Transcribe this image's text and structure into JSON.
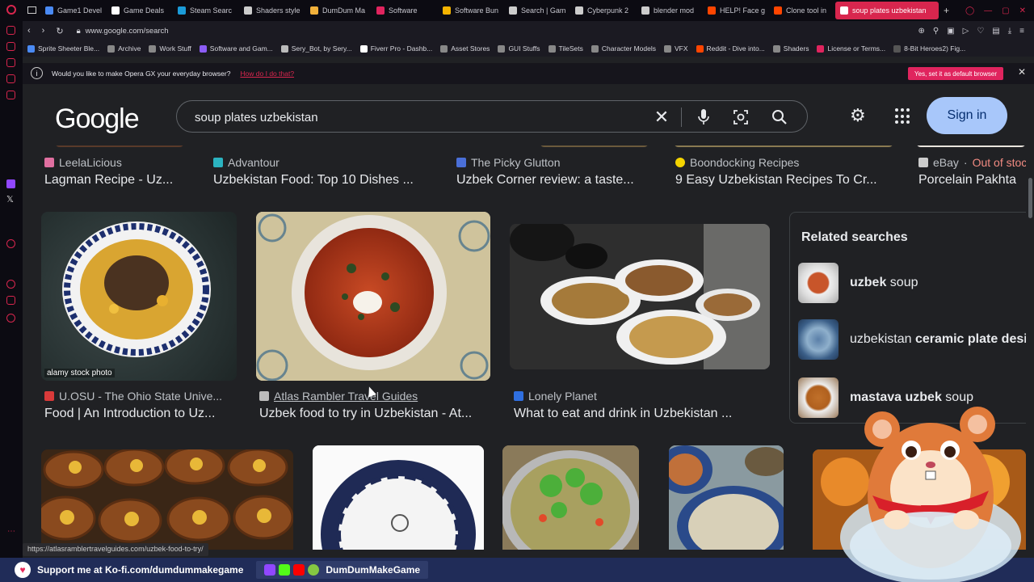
{
  "tabs": [
    {
      "label": "Game1 Devel",
      "color": "#4a8af4"
    },
    {
      "label": "Game Deals",
      "color": "#ffffff"
    },
    {
      "label": "Steam Searc",
      "color": "#1b9bd8"
    },
    {
      "label": "Shaders style",
      "color": "#cccccc"
    },
    {
      "label": "DumDum Ma",
      "color": "#f2b13b"
    },
    {
      "label": "Software",
      "color": "#e0245e"
    },
    {
      "label": "Software Bun",
      "color": "#f4b400"
    },
    {
      "label": "Search | Gam",
      "color": "#cccccc"
    },
    {
      "label": "Cyberpunk 2",
      "color": "#cccccc"
    },
    {
      "label": "blender mod",
      "color": "#cccccc"
    },
    {
      "label": "HELP! Face g",
      "color": "#ff4500"
    },
    {
      "label": "Clone tool in",
      "color": "#ff4500"
    },
    {
      "label": "soup plates uzbekistan",
      "color": "#ffffff",
      "active": true
    }
  ],
  "address": {
    "url": "www.google.com/search"
  },
  "bookmarks": [
    {
      "label": "Sprite Sheeter Ble...",
      "color": "#4a8af4"
    },
    {
      "label": "Archive",
      "color": "#888888"
    },
    {
      "label": "Work Stuff",
      "color": "#888888"
    },
    {
      "label": "Software and Gam...",
      "color": "#8c5cf6"
    },
    {
      "label": "Sery_Bot, by Sery...",
      "color": "#bbbbbb"
    },
    {
      "label": "Fiverr Pro - Dashb...",
      "color": "#ffffff"
    },
    {
      "label": "Asset Stores",
      "color": "#888888"
    },
    {
      "label": "GUI Stuffs",
      "color": "#888888"
    },
    {
      "label": "TileSets",
      "color": "#888888"
    },
    {
      "label": "Character Models",
      "color": "#888888"
    },
    {
      "label": "VFX",
      "color": "#888888"
    },
    {
      "label": "Reddit - Dive into...",
      "color": "#ff4500"
    },
    {
      "label": "Shaders",
      "color": "#888888"
    },
    {
      "label": "License or Terms...",
      "color": "#e0245e"
    },
    {
      "label": "8-Bit Heroes2) Fig...",
      "color": "#555555"
    }
  ],
  "infobar": {
    "message": "Would you like to make Opera GX your everyday browser?",
    "link": "How do I do that?",
    "yes_button": "Yes, set it as default browser"
  },
  "google": {
    "logo": "Google",
    "query": "soup plates uzbekistan",
    "sign_in": "Sign in"
  },
  "top_row": [
    {
      "source": "LeelaLicious",
      "title": "Lagman Recipe - Uz...",
      "color": "#e06fa0"
    },
    {
      "source": "Advantour",
      "title": "Uzbekistan Food: Top 10 Dishes ...",
      "color": "#2bb3c0"
    },
    {
      "source": "The Picky Glutton",
      "title": "Uzbek Corner review: a taste...",
      "color": "#4a6fd8"
    },
    {
      "source": "Boondocking Recipes",
      "title": "9 Easy Uzbekistan Recipes To Cr...",
      "color": "#f4d400"
    },
    {
      "source": "eBay",
      "source_extra": "Out of stock",
      "title": "Porcelain Pakhta",
      "color": "#cccccc"
    }
  ],
  "middle_row": [
    {
      "source": "U.OSU - The Ohio State Unive...",
      "title": "Food | An Introduction to Uz...",
      "color": "#d93a3a",
      "watermark": "alamy stock photo"
    },
    {
      "source": "Atlas Rambler Travel Guides",
      "title": "Uzbek food to try in Uzbekistan - At...",
      "color": "#bbbbbb"
    },
    {
      "source": "Lonely Planet",
      "title": "What to eat and drink in Uzbekistan ...",
      "color": "#2f6fe0"
    }
  ],
  "related": {
    "title": "Related searches",
    "items": [
      {
        "plain": "",
        "bold": "uzbek",
        "rest": " soup"
      },
      {
        "plain": "uzbekistan ",
        "bold": "ceramic plate desig",
        "rest": ""
      },
      {
        "plain": "",
        "bold": "mastava uzbek",
        "rest": " soup"
      }
    ]
  },
  "status_url": "https://atlasramblertravelguides.com/uzbek-food-to-try/",
  "bottom_bar": {
    "kofi": "Support me at Ko-fi.com/dumdummakegame",
    "channel": "DumDumMakeGame"
  }
}
